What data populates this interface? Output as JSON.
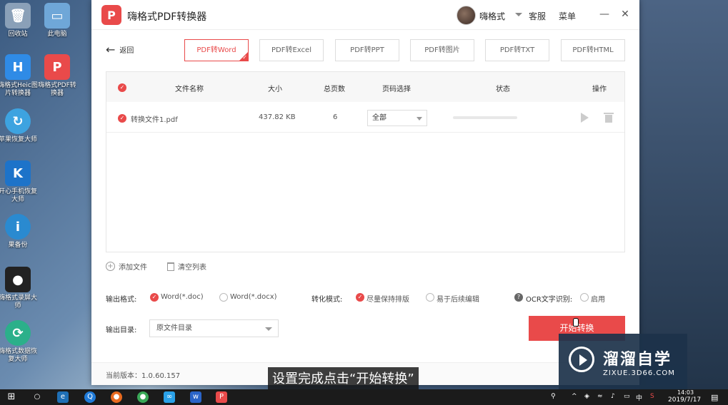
{
  "desktop": {
    "icons": [
      {
        "label": "回收站",
        "icon": "recycle-bin-icon",
        "color": "#8aa0b8"
      },
      {
        "label": "此电脑",
        "icon": "computer-icon",
        "color": "#6fa7d8"
      },
      {
        "label": "嗨格式Heic图片转换器",
        "icon": "heic-converter-icon",
        "color": "#2f8be6"
      },
      {
        "label": "嗨格式PDF转换器",
        "icon": "pdf-converter-icon",
        "color": "#e94a4a"
      },
      {
        "label": "苹果恢复大师",
        "icon": "apple-recovery-icon",
        "color": "#3da3e0"
      },
      {
        "label": "开心手机恢复大师",
        "icon": "phone-recovery-icon",
        "color": "#1d73c9"
      },
      {
        "label": "果备份",
        "icon": "backup-icon",
        "color": "#2a8ad0"
      },
      {
        "label": "嗨格式录屏大师",
        "icon": "screen-recorder-icon",
        "color": "#222222"
      },
      {
        "label": "嗨格式数据恢复大师",
        "icon": "data-recovery-icon",
        "color": "#2bb08a"
      }
    ]
  },
  "app": {
    "logo_glyph": "P",
    "title": "嗨格式PDF转换器",
    "user_name": "嗨格式",
    "service_label": "客服",
    "menu_label": "菜单",
    "minimize_glyph": "—",
    "close_glyph": "✕",
    "back_label": "返回",
    "tabs": [
      {
        "label": "PDF转Word",
        "active": true
      },
      {
        "label": "PDF转Excel",
        "active": false
      },
      {
        "label": "PDF转PPT",
        "active": false
      },
      {
        "label": "PDF转图片",
        "active": false
      },
      {
        "label": "PDF转TXT",
        "active": false
      },
      {
        "label": "PDF转HTML",
        "active": false
      }
    ],
    "table": {
      "headers": {
        "name": "文件名称",
        "size": "大小",
        "pages": "总页数",
        "page_select": "页码选择",
        "status": "状态",
        "actions": "操作"
      },
      "rows": [
        {
          "name": "转换文件1.pdf",
          "size": "437.82 KB",
          "pages": "6",
          "page_select": "全部"
        }
      ]
    },
    "add_file_label": "添加文件",
    "clear_list_label": "清空列表",
    "output_format": {
      "label": "输出格式:",
      "options": [
        "Word(*.doc)",
        "Word(*.docx)"
      ],
      "selected": 0
    },
    "convert_mode": {
      "label": "转化模式:",
      "options": [
        "尽量保持排版",
        "易于后续编辑"
      ],
      "selected": 0
    },
    "ocr": {
      "label": "OCR文字识别:",
      "option": "启用"
    },
    "output_dir": {
      "label": "输出目录:",
      "value": "原文件目录"
    },
    "start_button": "开始转换",
    "version": "当前版本：1.0.60.157",
    "accent_color": "#e94a4a"
  },
  "watermark": {
    "title": "溜溜自学",
    "subtitle": "ZIXUE.3D66.COM"
  },
  "subtitle_caption": "设置完成点击“开始转换”",
  "taskbar": {
    "clock_time": "14:03",
    "clock_date": "2019/7/17",
    "ime": "中"
  }
}
